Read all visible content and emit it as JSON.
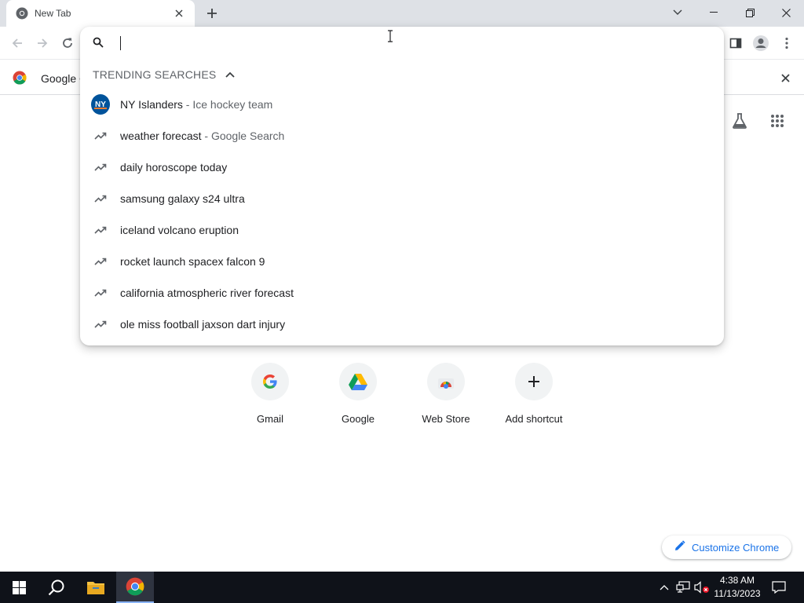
{
  "tab": {
    "title": "New Tab",
    "close_icon": "close-icon"
  },
  "infobar": {
    "text": "Google Chrome"
  },
  "omnibox": {
    "value": "",
    "section_title": "TRENDING SEARCHES",
    "suggestions": [
      {
        "text": "NY Islanders",
        "separator": " - ",
        "desc": "Ice hockey team",
        "icon": "ny-islanders-logo"
      },
      {
        "text": "weather forecast",
        "separator": " - ",
        "desc": "Google Search",
        "icon": "trending-icon"
      },
      {
        "text": "daily horoscope today",
        "icon": "trending-icon"
      },
      {
        "text": "samsung galaxy s24 ultra",
        "icon": "trending-icon"
      },
      {
        "text": "iceland volcano eruption",
        "icon": "trending-icon"
      },
      {
        "text": "rocket launch spacex falcon 9",
        "icon": "trending-icon"
      },
      {
        "text": "california atmospheric river forecast",
        "icon": "trending-icon"
      },
      {
        "text": "ole miss football jaxson dart injury",
        "icon": "trending-icon"
      }
    ]
  },
  "shortcuts": [
    {
      "label": "Gmail",
      "icon": "google-g-icon"
    },
    {
      "label": "Google",
      "icon": "drive-icon"
    },
    {
      "label": "Web Store",
      "icon": "web-store-icon"
    },
    {
      "label": "Add shortcut",
      "icon": "plus-icon"
    }
  ],
  "customize": {
    "label": "Customize Chrome"
  },
  "taskbar": {
    "time": "4:38 AM",
    "date": "11/13/2023"
  },
  "colors": {
    "accent": "#1a73e8",
    "taskbar": "#0f1219"
  }
}
